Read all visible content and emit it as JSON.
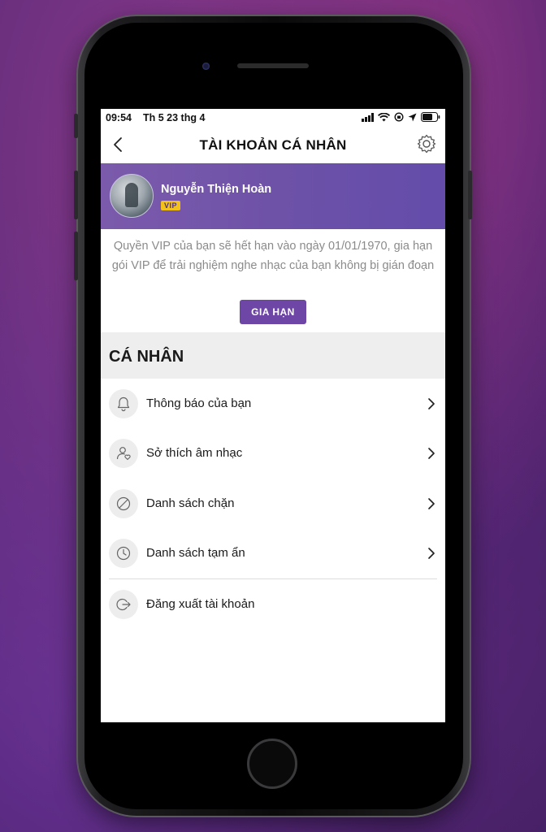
{
  "status_bar": {
    "time": "09:54",
    "date": "Th 5 23 thg 4"
  },
  "nav": {
    "title": "TÀI KHOẢN CÁ NHÂN"
  },
  "profile": {
    "name": "Nguyễn Thiện Hoàn",
    "badge": "VIP"
  },
  "vip_notice": {
    "text": "Quyền VIP của bạn sẽ hết hạn vào ngày 01/01/1970, gia hạn gói VIP để trải nghiệm nghe nhạc của bạn không bị gián đoạn",
    "renew_label": "GIA HẠN"
  },
  "section": {
    "title": "CÁ NHÂN"
  },
  "menu": [
    {
      "label": "Thông báo của bạn",
      "icon": "bell-icon"
    },
    {
      "label": "Sở thích âm nhạc",
      "icon": "user-heart-icon"
    },
    {
      "label": "Danh sách chặn",
      "icon": "block-icon"
    },
    {
      "label": "Danh sách tạm ẩn",
      "icon": "clock-icon"
    },
    {
      "label": "Đăng xuất tài khoản",
      "icon": "logout-icon"
    }
  ],
  "colors": {
    "accent": "#6e47a6",
    "header_bg": "#7b5aab",
    "vip_badge": "#f2c21a"
  }
}
